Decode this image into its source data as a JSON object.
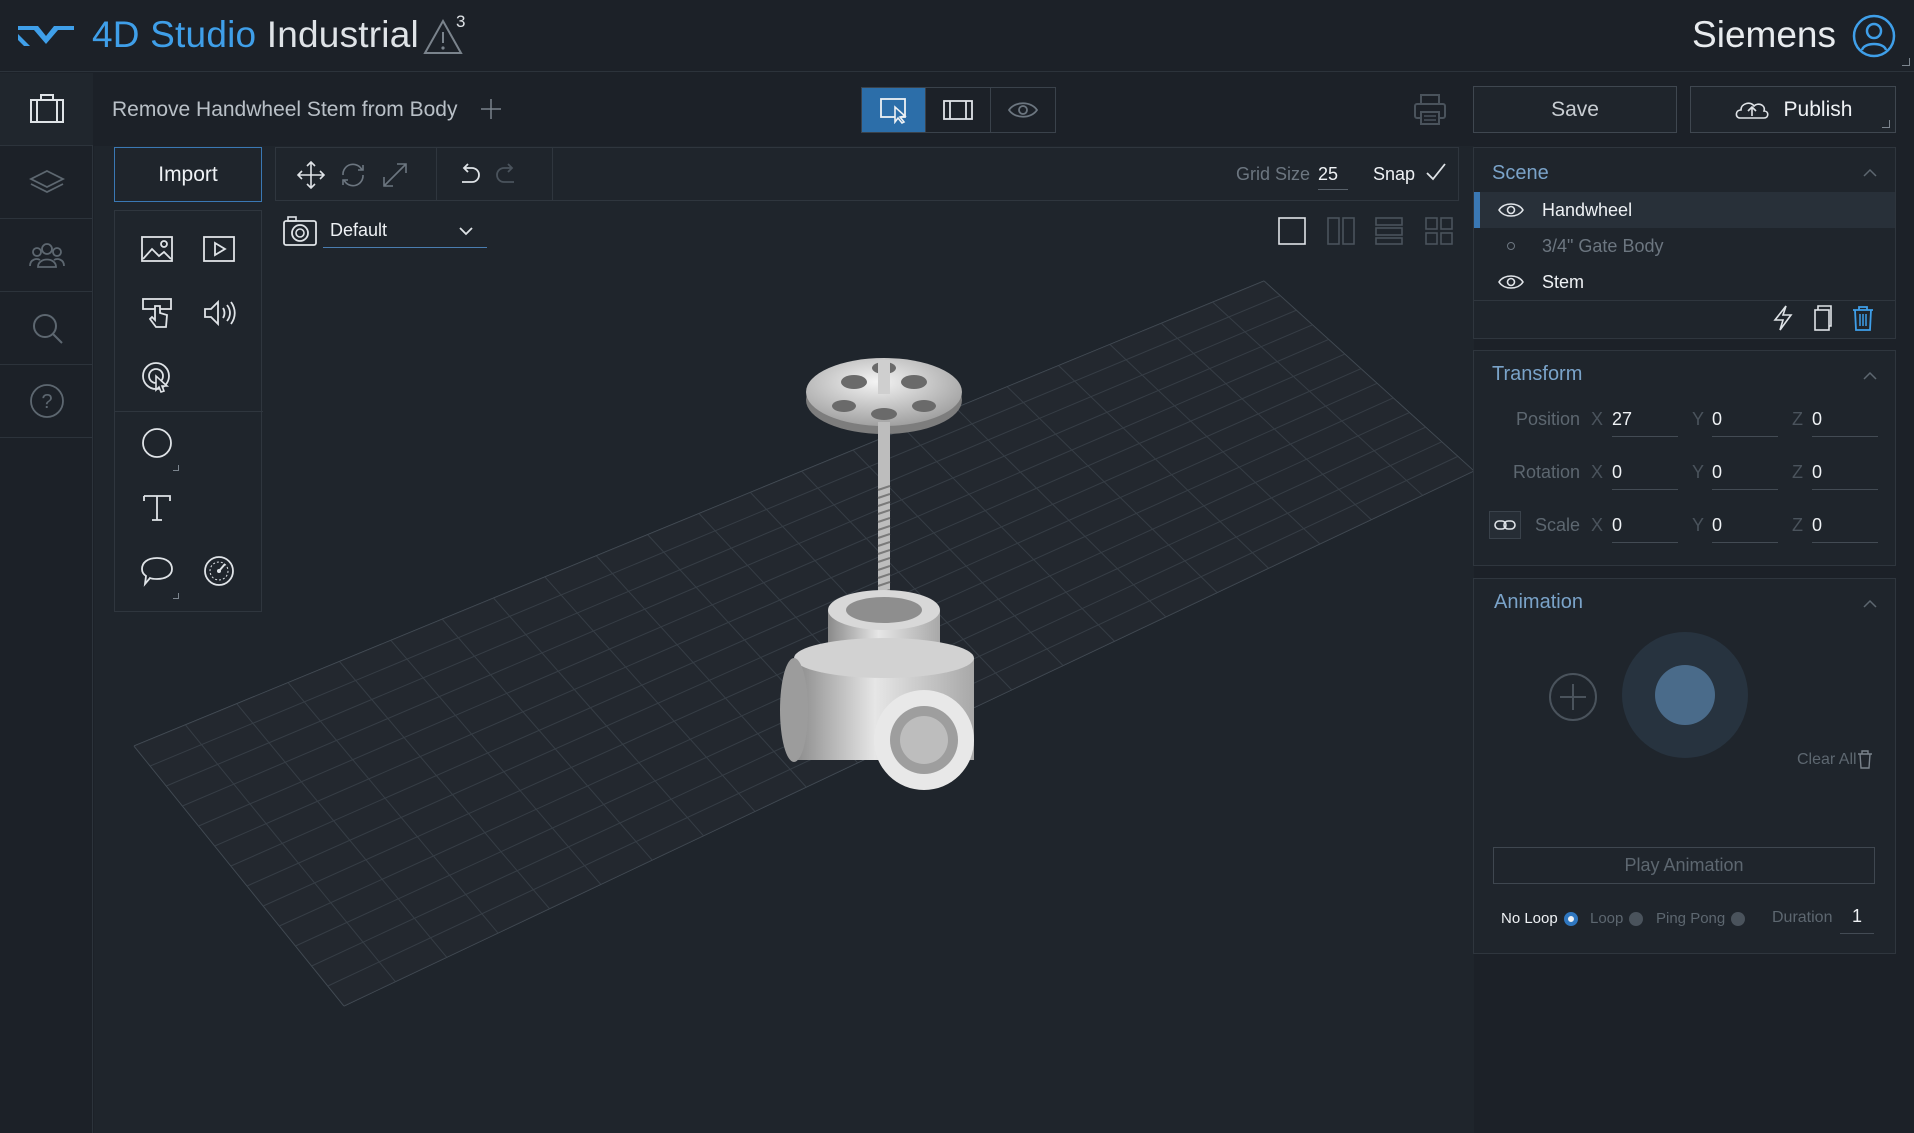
{
  "header": {
    "brand": "4D Studio",
    "product": " Industrial",
    "warning_count": "3",
    "company": "Siemens"
  },
  "sidebar": {
    "items": [
      {
        "name": "projects",
        "icon": "briefcase-icon"
      },
      {
        "name": "layers",
        "icon": "layers-icon"
      },
      {
        "name": "users",
        "icon": "users-icon"
      },
      {
        "name": "search",
        "icon": "search-icon"
      },
      {
        "name": "help",
        "icon": "help-icon"
      }
    ]
  },
  "document": {
    "title": "Remove Handwheel Stem from Body"
  },
  "modes": [
    "select-mode",
    "preview-mode",
    "view-mode"
  ],
  "actions": {
    "save_label": "Save",
    "publish_label": "Publish"
  },
  "import_panel": {
    "label": "Import"
  },
  "toolbar": {
    "grid_size_label": "Grid Size",
    "grid_size_value": "25",
    "snap_label": "Snap"
  },
  "camera": {
    "selected": "Default"
  },
  "scene": {
    "title": "Scene",
    "items": [
      {
        "label": "Handwheel",
        "visible": true,
        "selected": true
      },
      {
        "label": "3/4\" Gate Body",
        "visible": false,
        "selected": false
      },
      {
        "label": "Stem",
        "visible": true,
        "selected": false
      }
    ]
  },
  "transform": {
    "title": "Transform",
    "position": {
      "label": "Position",
      "x": "27",
      "y": "0",
      "z": "0"
    },
    "rotation": {
      "label": "Rotation",
      "x": "0",
      "y": "0",
      "z": "0"
    },
    "scale": {
      "label": "Scale",
      "x": "0",
      "y": "0",
      "z": "0"
    },
    "axis": {
      "x": "X",
      "y": "Y",
      "z": "Z"
    }
  },
  "animation": {
    "title": "Animation",
    "clear_all_label": "Clear All",
    "play_label": "Play Animation",
    "loop_options": [
      {
        "label": "No Loop",
        "selected": true
      },
      {
        "label": "Loop",
        "selected": false
      },
      {
        "label": "Ping Pong",
        "selected": false
      }
    ],
    "duration_label": "Duration",
    "duration_value": "1"
  },
  "colors": {
    "accent": "#3f9fe9",
    "background": "#1c2128",
    "panel": "#1f252c",
    "selected_row": "#283039"
  }
}
